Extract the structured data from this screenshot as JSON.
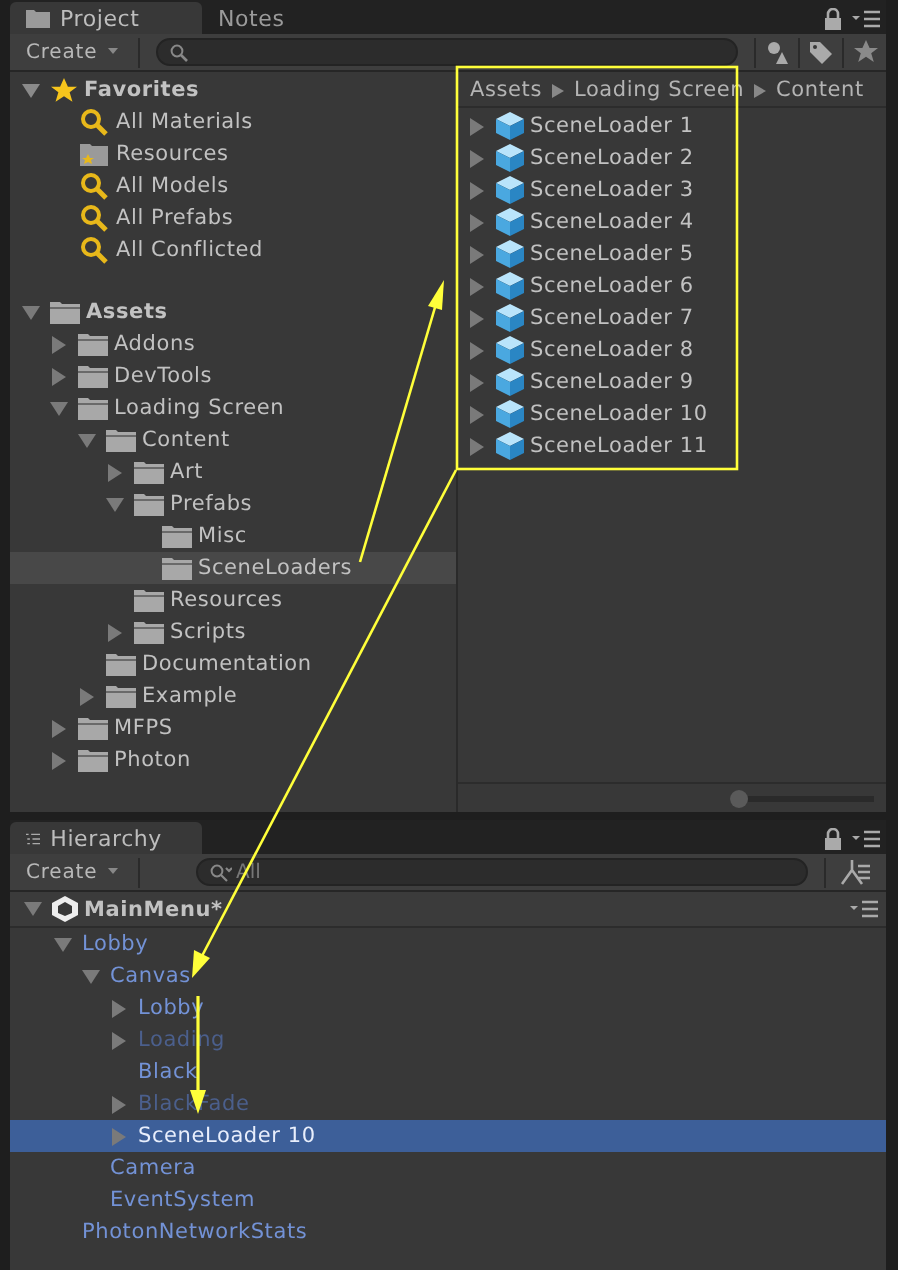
{
  "project_panel": {
    "tabs": [
      {
        "label": "Project",
        "selected": true
      },
      {
        "label": "Notes",
        "selected": false
      }
    ],
    "create_button": "Create",
    "favorites": {
      "label": "Favorites",
      "expanded": true,
      "items": [
        {
          "label": "All Materials",
          "kind": "search"
        },
        {
          "label": "Resources",
          "kind": "folder"
        },
        {
          "label": "All Models",
          "kind": "search"
        },
        {
          "label": "All Prefabs",
          "kind": "search"
        },
        {
          "label": "All Conflicted",
          "kind": "search"
        }
      ]
    },
    "assets_tree": [
      {
        "label": "Assets",
        "expanded": true,
        "selected": false,
        "children": [
          {
            "label": "Addons",
            "expanded": false,
            "selected": false
          },
          {
            "label": "DevTools",
            "expanded": false,
            "selected": false
          },
          {
            "label": "Loading Screen",
            "expanded": true,
            "selected": false,
            "children": [
              {
                "label": "Content",
                "expanded": true,
                "selected": false,
                "children": [
                  {
                    "label": "Art",
                    "expanded": false,
                    "selected": false
                  },
                  {
                    "label": "Prefabs",
                    "expanded": true,
                    "selected": false,
                    "children": [
                      {
                        "label": "Misc",
                        "selected": false
                      },
                      {
                        "label": "SceneLoaders",
                        "selected": true
                      }
                    ]
                  },
                  {
                    "label": "Resources",
                    "selected": false
                  },
                  {
                    "label": "Scripts",
                    "expanded": false,
                    "selected": false
                  }
                ]
              },
              {
                "label": "Documentation",
                "selected": false
              },
              {
                "label": "Example",
                "expanded": false,
                "selected": false
              }
            ]
          },
          {
            "label": "MFPS",
            "expanded": false,
            "selected": false
          },
          {
            "label": "Photon",
            "expanded": false,
            "selected": false
          }
        ]
      }
    ],
    "breadcrumb": [
      "Assets",
      "Loading Screen",
      "Content"
    ],
    "prefabs": [
      {
        "label": "SceneLoader 1",
        "expanded": false
      },
      {
        "label": "SceneLoader 2",
        "expanded": false
      },
      {
        "label": "SceneLoader 3",
        "expanded": false
      },
      {
        "label": "SceneLoader 4",
        "expanded": false
      },
      {
        "label": "SceneLoader 5",
        "expanded": false
      },
      {
        "label": "SceneLoader 6",
        "expanded": false
      },
      {
        "label": "SceneLoader 7",
        "expanded": false
      },
      {
        "label": "SceneLoader 8",
        "expanded": false
      },
      {
        "label": "SceneLoader 9",
        "expanded": false
      },
      {
        "label": "SceneLoader 10",
        "expanded": false
      },
      {
        "label": "SceneLoader 11",
        "expanded": false
      }
    ],
    "zoom_slider": {
      "level": 0.05
    }
  },
  "hierarchy_panel": {
    "tab": "Hierarchy",
    "create_button": "Create",
    "search": {
      "placeholder": "All"
    },
    "scene": {
      "label": "MainMenu*",
      "expanded": true
    },
    "tree": [
      {
        "label": "Lobby",
        "expanded": true,
        "inactive": false,
        "selected": false,
        "children": [
          {
            "label": "Canvas",
            "expanded": true,
            "inactive": false,
            "selected": false,
            "children": [
              {
                "label": "Lobby",
                "expanded": false,
                "inactive": false,
                "selected": false
              },
              {
                "label": "Loading",
                "expanded": false,
                "inactive": true,
                "selected": false
              },
              {
                "label": "Black",
                "inactive": false,
                "selected": false
              },
              {
                "label": "BlackFade",
                "expanded": false,
                "inactive": true,
                "selected": false
              },
              {
                "label": "SceneLoader 10",
                "expanded": false,
                "inactive": false,
                "selected": true
              }
            ]
          },
          {
            "label": "Camera",
            "inactive": false,
            "selected": false
          },
          {
            "label": "EventSystem",
            "inactive": false,
            "selected": false
          }
        ]
      },
      {
        "label": "PhotonNetworkStats",
        "inactive": false,
        "selected": false
      }
    ]
  }
}
